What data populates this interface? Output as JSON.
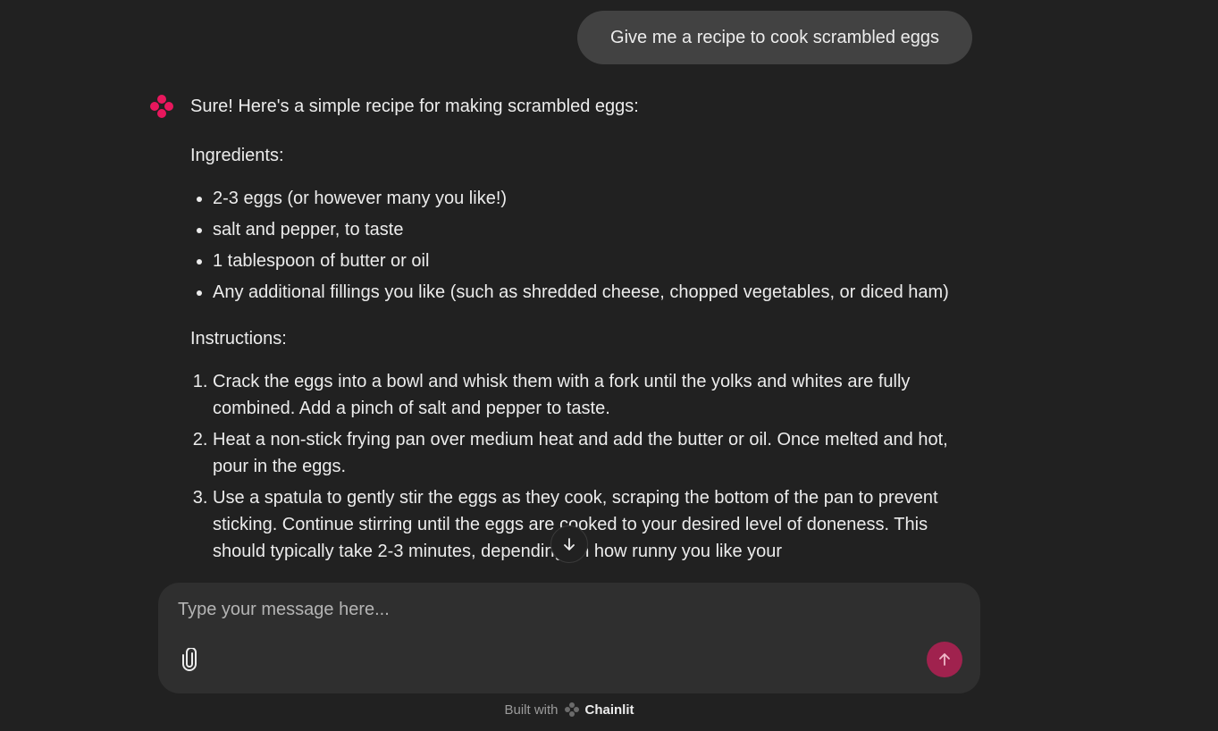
{
  "user_message": "Give me a recipe to cook scrambled eggs",
  "assistant": {
    "intro": "Sure! Here's a simple recipe for making scrambled eggs:",
    "ingredients_label": "Ingredients:",
    "ingredients": [
      "2-3 eggs (or however many you like!)",
      "salt and pepper, to taste",
      "1 tablespoon of butter or oil",
      "Any additional fillings you like (such as shredded cheese, chopped vegetables, or diced ham)"
    ],
    "instructions_label": "Instructions:",
    "instructions": [
      "Crack the eggs into a bowl and whisk them with a fork until the yolks and whites are fully combined. Add a pinch of salt and pepper to taste.",
      "Heat a non-stick frying pan over medium heat and add the butter or oil. Once melted and hot, pour in the eggs.",
      "Use a spatula to gently stir the eggs as they cook, scraping the bottom of the pan to prevent sticking. Continue stirring until the eggs are cooked to your desired level of doneness. This should typically take 2-3 minutes, depending on how runny you like your"
    ]
  },
  "composer": {
    "placeholder": "Type your message here..."
  },
  "footer": {
    "built_with": "Built with",
    "brand": "Chainlit"
  },
  "colors": {
    "background": "#212121",
    "user_bubble": "#424242",
    "composer": "#2f2f2f",
    "accent": "#e8175d",
    "send_button": "#a0224e"
  },
  "icons": {
    "avatar": "chainlit-logo-icon",
    "scroll": "arrow-down-icon",
    "attach": "paperclip-icon",
    "send": "arrow-up-icon"
  }
}
